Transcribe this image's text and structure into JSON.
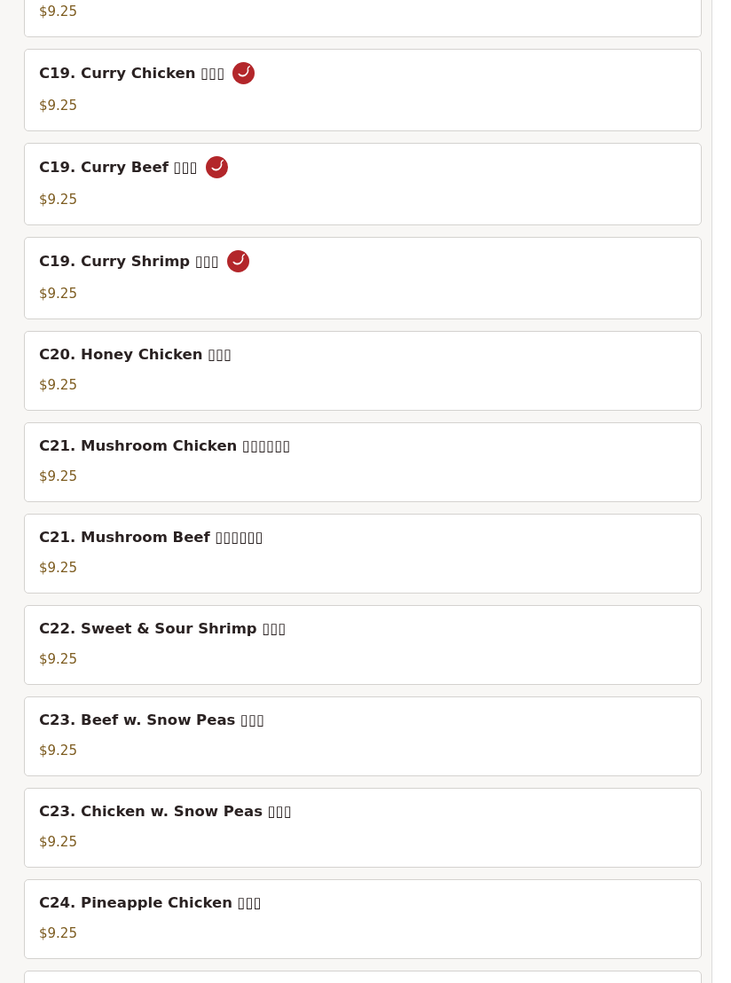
{
  "menu_items": [
    {
      "price": "$9.25"
    },
    {
      "name": "C19. Curry Chicken ▯▯▯",
      "price": "$9.25",
      "spicy": true
    },
    {
      "name": "C19. Curry Beef ▯▯▯",
      "price": "$9.25",
      "spicy": true
    },
    {
      "name": "C19. Curry Shrimp ▯▯▯",
      "price": "$9.25",
      "spicy": true
    },
    {
      "name": "C20. Honey Chicken ▯▯▯",
      "price": "$9.25",
      "spicy": false
    },
    {
      "name": "C21. Mushroom Chicken ▯▯▯▯▯▯",
      "price": "$9.25",
      "spicy": false
    },
    {
      "name": "C21. Mushroom Beef ▯▯▯▯▯▯",
      "price": "$9.25",
      "spicy": false
    },
    {
      "name": "C22. Sweet & Sour Shrimp ▯▯▯",
      "price": "$9.25",
      "spicy": false
    },
    {
      "name": "C23. Beef w. Snow Peas ▯▯▯",
      "price": "$9.25",
      "spicy": false
    },
    {
      "name": "C23. Chicken w. Snow Peas ▯▯▯",
      "price": "$9.25",
      "spicy": false
    },
    {
      "name": "C24. Pineapple Chicken ▯▯▯",
      "price": "$9.25",
      "spicy": false
    }
  ]
}
